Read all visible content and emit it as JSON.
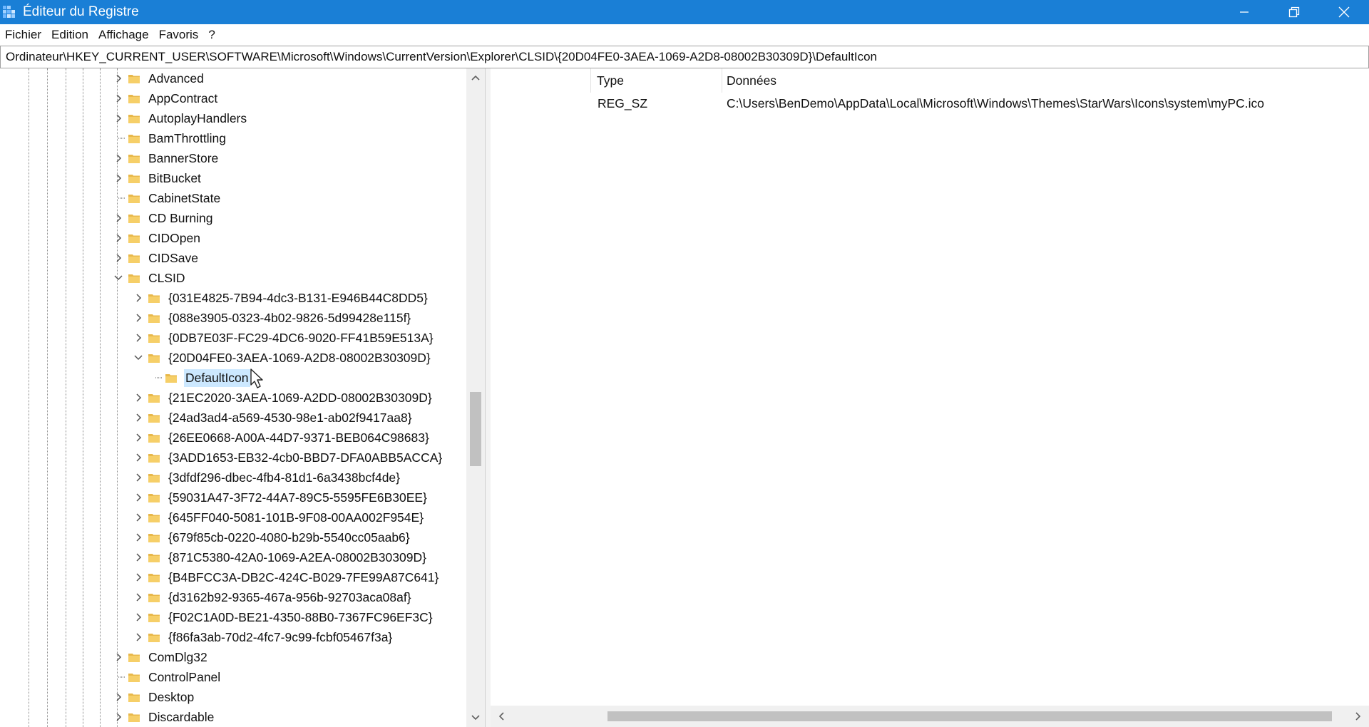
{
  "window": {
    "title": "Éditeur du Registre",
    "minimize_icon": "minimize-icon",
    "restore_icon": "restore-icon",
    "close_icon": "close-icon"
  },
  "menu": [
    "Fichier",
    "Edition",
    "Affichage",
    "Favoris",
    "?"
  ],
  "address": "Ordinateur\\HKEY_CURRENT_USER\\SOFTWARE\\Microsoft\\Windows\\CurrentVersion\\Explorer\\CLSID\\{20D04FE0-3AEA-1069-A2D8-08002B30309D}\\DefaultIcon",
  "tree": {
    "level1": [
      {
        "label": "Advanced",
        "expander": "collapsed"
      },
      {
        "label": "AppContract",
        "expander": "collapsed"
      },
      {
        "label": "AutoplayHandlers",
        "expander": "collapsed"
      },
      {
        "label": "BamThrottling",
        "expander": "none"
      },
      {
        "label": "BannerStore",
        "expander": "collapsed"
      },
      {
        "label": "BitBucket",
        "expander": "collapsed"
      },
      {
        "label": "CabinetState",
        "expander": "none"
      },
      {
        "label": "CD Burning",
        "expander": "collapsed"
      },
      {
        "label": "CIDOpen",
        "expander": "collapsed"
      },
      {
        "label": "CIDSave",
        "expander": "collapsed"
      },
      {
        "label": "CLSID",
        "expander": "expanded"
      }
    ],
    "clsid_children_before": [
      {
        "label": "{031E4825-7B94-4dc3-B131-E946B44C8DD5}",
        "expander": "collapsed"
      },
      {
        "label": "{088e3905-0323-4b02-9826-5d99428e115f}",
        "expander": "collapsed"
      },
      {
        "label": "{0DB7E03F-FC29-4DC6-9020-FF41B59E513A}",
        "expander": "collapsed"
      },
      {
        "label": "{20D04FE0-3AEA-1069-A2D8-08002B30309D}",
        "expander": "expanded"
      }
    ],
    "selected": {
      "label": "DefaultIcon"
    },
    "clsid_children_after": [
      {
        "label": "{21EC2020-3AEA-1069-A2DD-08002B30309D}",
        "expander": "collapsed"
      },
      {
        "label": "{24ad3ad4-a569-4530-98e1-ab02f9417aa8}",
        "expander": "collapsed"
      },
      {
        "label": "{26EE0668-A00A-44D7-9371-BEB064C98683}",
        "expander": "collapsed"
      },
      {
        "label": "{3ADD1653-EB32-4cb0-BBD7-DFA0ABB5ACCA}",
        "expander": "collapsed"
      },
      {
        "label": "{3dfdf296-dbec-4fb4-81d1-6a3438bcf4de}",
        "expander": "collapsed"
      },
      {
        "label": "{59031A47-3F72-44A7-89C5-5595FE6B30EE}",
        "expander": "collapsed"
      },
      {
        "label": "{645FF040-5081-101B-9F08-00AA002F954E}",
        "expander": "collapsed"
      },
      {
        "label": "{679f85cb-0220-4080-b29b-5540cc05aab6}",
        "expander": "collapsed"
      },
      {
        "label": "{871C5380-42A0-1069-A2EA-08002B30309D}",
        "expander": "collapsed"
      },
      {
        "label": "{B4BFCC3A-DB2C-424C-B029-7FE99A87C641}",
        "expander": "collapsed"
      },
      {
        "label": "{d3162b92-9365-467a-956b-92703aca08af}",
        "expander": "collapsed"
      },
      {
        "label": "{F02C1A0D-BE21-4350-88B0-7367FC96EF3C}",
        "expander": "collapsed"
      },
      {
        "label": "{f86fa3ab-70d2-4fc7-9c99-fcbf05467f3a}",
        "expander": "collapsed"
      }
    ],
    "level1_after": [
      {
        "label": "ComDlg32",
        "expander": "collapsed"
      },
      {
        "label": "ControlPanel",
        "expander": "none"
      },
      {
        "label": "Desktop",
        "expander": "collapsed"
      },
      {
        "label": "Discardable",
        "expander": "collapsed"
      }
    ]
  },
  "values": {
    "columns": {
      "type": "Type",
      "data": "Données"
    },
    "rows": [
      {
        "type": "REG_SZ",
        "data": "C:\\Users\\BenDemo\\AppData\\Local\\Microsoft\\Windows\\Themes\\StarWars\\Icons\\system\\myPC.ico"
      }
    ]
  },
  "colors": {
    "titlebar": "#1a7fd6",
    "folder": "#e8b84a",
    "selection": "#cce8ff"
  }
}
